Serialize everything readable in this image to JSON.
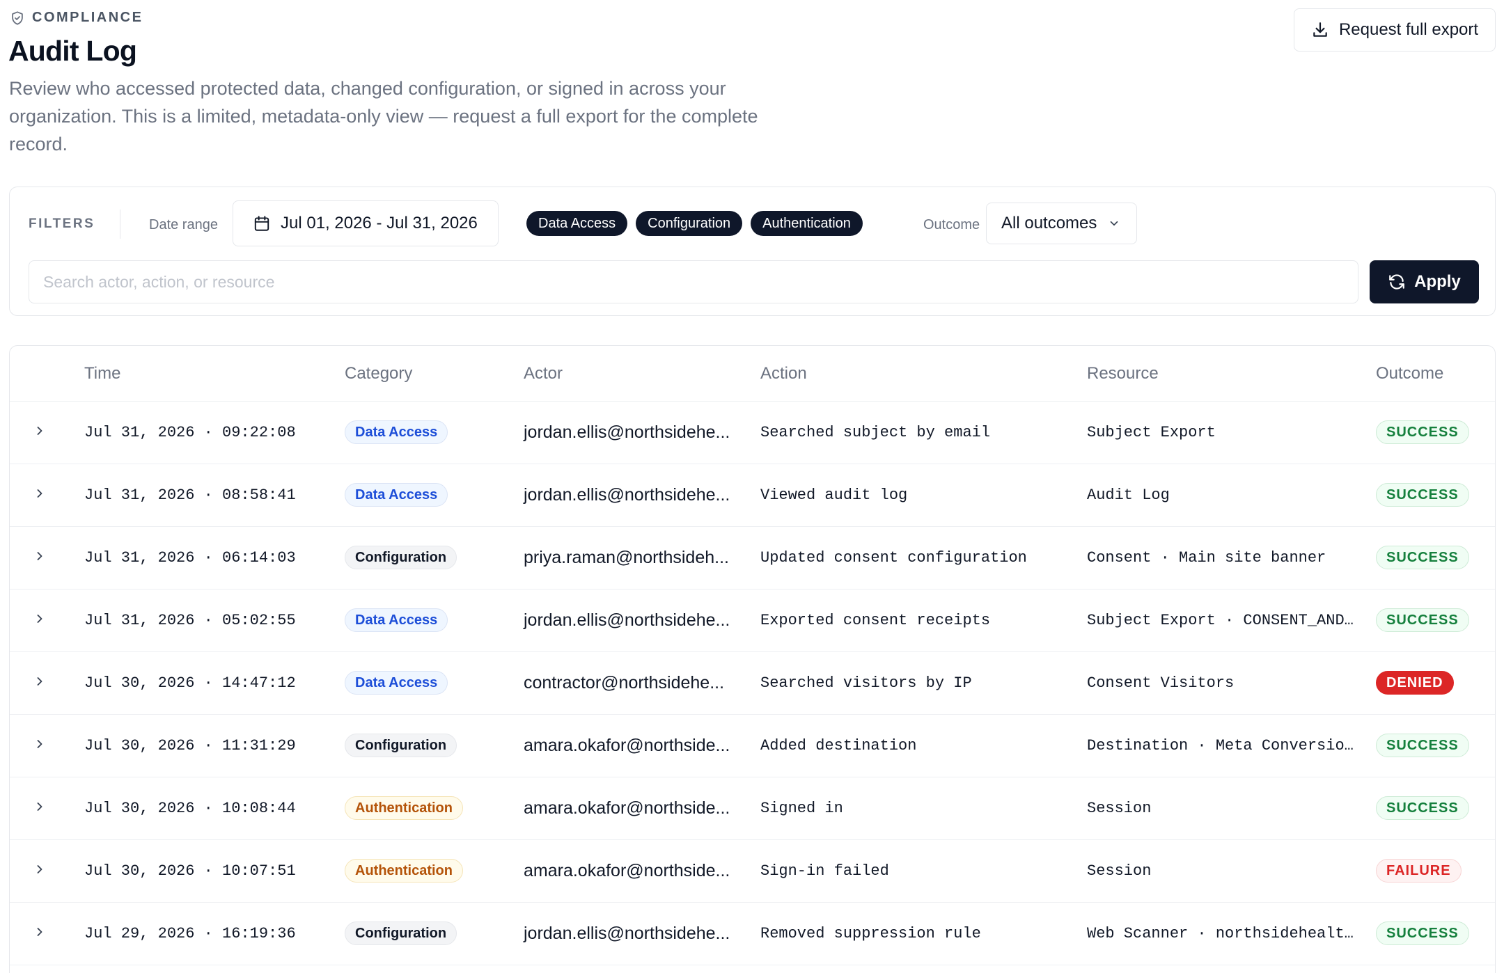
{
  "header": {
    "eyebrow": "COMPLIANCE",
    "title": "Audit Log",
    "description": "Review who accessed protected data, changed configuration, or signed in across your organization. This is a limited, metadata-only view — request a full export for the complete record.",
    "export_label": "Request full export"
  },
  "filters": {
    "label": "FILTERS",
    "date_label": "Date range",
    "date_value": "Jul 01, 2026 - Jul 31, 2026",
    "chips": [
      "Data Access",
      "Configuration",
      "Authentication"
    ],
    "outcome_label": "Outcome",
    "outcome_value": "All outcomes",
    "search_placeholder": "Search actor, action, or resource",
    "apply_label": "Apply"
  },
  "table": {
    "columns": {
      "time": "Time",
      "category": "Category",
      "actor": "Actor",
      "action": "Action",
      "resource": "Resource",
      "outcome": "Outcome"
    },
    "rows": [
      {
        "time": "Jul 31, 2026 · 09:22:08",
        "category": "Data Access",
        "cat": "data",
        "actor": "jordan.ellis@northsidehe...",
        "action": "Searched subject by email",
        "resource": "Subject Export",
        "outcome": "SUCCESS",
        "out": "success"
      },
      {
        "time": "Jul 31, 2026 · 08:58:41",
        "category": "Data Access",
        "cat": "data",
        "actor": "jordan.ellis@northsidehe...",
        "action": "Viewed audit log",
        "resource": "Audit Log",
        "outcome": "SUCCESS",
        "out": "success"
      },
      {
        "time": "Jul 31, 2026 · 06:14:03",
        "category": "Configuration",
        "cat": "config",
        "actor": "priya.raman@northsideh...",
        "action": "Updated consent configuration",
        "resource": "Consent · Main site banner",
        "outcome": "SUCCESS",
        "out": "success"
      },
      {
        "time": "Jul 31, 2026 · 05:02:55",
        "category": "Data Access",
        "cat": "data",
        "actor": "jordan.ellis@northsidehe...",
        "action": "Exported consent receipts",
        "resource": "Subject Export · CONSENT_AND…",
        "outcome": "SUCCESS",
        "out": "success"
      },
      {
        "time": "Jul 30, 2026 · 14:47:12",
        "category": "Data Access",
        "cat": "data",
        "actor": "contractor@northsidehe...",
        "action": "Searched visitors by IP",
        "resource": "Consent Visitors",
        "outcome": "DENIED",
        "out": "denied"
      },
      {
        "time": "Jul 30, 2026 · 11:31:29",
        "category": "Configuration",
        "cat": "config",
        "actor": "amara.okafor@northside...",
        "action": "Added destination",
        "resource": "Destination · Meta Conversio…",
        "outcome": "SUCCESS",
        "out": "success"
      },
      {
        "time": "Jul 30, 2026 · 10:08:44",
        "category": "Authentication",
        "cat": "auth",
        "actor": "amara.okafor@northside...",
        "action": "Signed in",
        "resource": "Session",
        "outcome": "SUCCESS",
        "out": "success"
      },
      {
        "time": "Jul 30, 2026 · 10:07:51",
        "category": "Authentication",
        "cat": "auth",
        "actor": "amara.okafor@northside...",
        "action": "Sign-in failed",
        "resource": "Session",
        "outcome": "FAILURE",
        "out": "failure"
      },
      {
        "time": "Jul 29, 2026 · 16:19:36",
        "category": "Configuration",
        "cat": "config",
        "actor": "jordan.ellis@northsidehe...",
        "action": "Removed suppression rule",
        "resource": "Web Scanner · northsidehealt…",
        "outcome": "SUCCESS",
        "out": "success"
      }
    ]
  }
}
